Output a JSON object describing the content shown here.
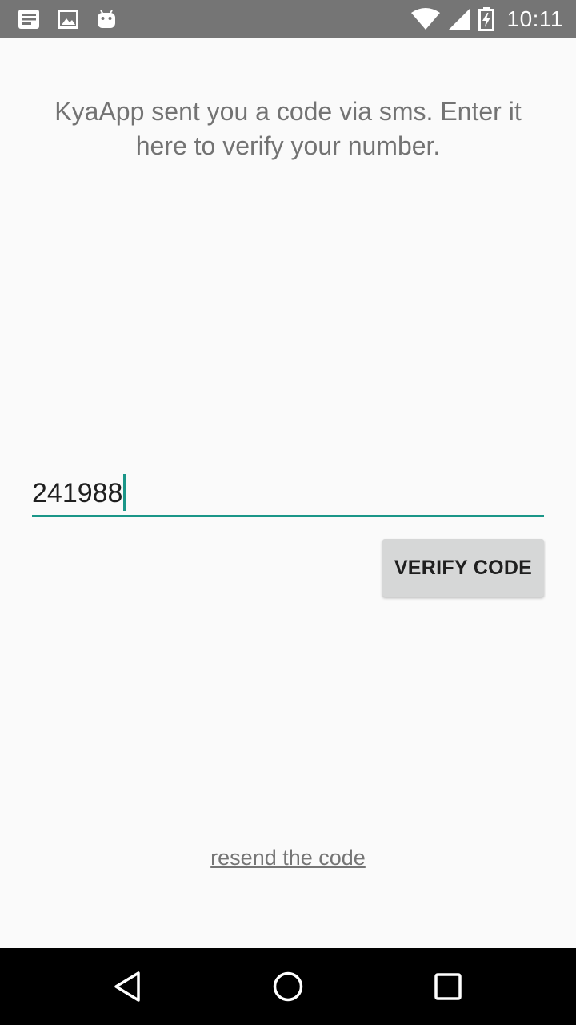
{
  "status_bar": {
    "time": "10:11",
    "left_icons": [
      "notes-icon",
      "image-icon",
      "android-icon"
    ],
    "right_icons": [
      "wifi-icon",
      "signal-icon",
      "battery-charging-icon"
    ]
  },
  "verify": {
    "message": "KyaApp sent you a code via sms. Enter it here to verify your number.",
    "code_value": "241988",
    "button_label": "VERIFY CODE",
    "resend_label": "resend the code"
  },
  "colors": {
    "accent": "#1a9688",
    "status_bar": "#757575",
    "background": "#fafafa",
    "button": "#d6d7d7"
  },
  "nav_bar": {
    "buttons": [
      "back-icon",
      "home-icon",
      "recents-icon"
    ]
  }
}
